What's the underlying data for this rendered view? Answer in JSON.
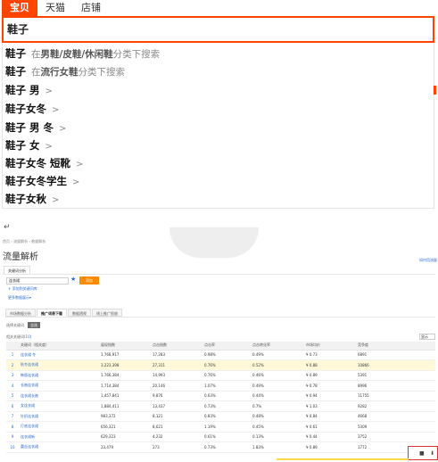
{
  "search": {
    "tabs": [
      "宝贝",
      "天猫",
      "店铺"
    ],
    "query": "鞋子"
  },
  "suggestions": [
    {
      "q": "鞋子",
      "hint_pre": "在",
      "hint_cat": "男鞋/皮鞋/休闲鞋",
      "hint_post": "分类下搜索"
    },
    {
      "q": "鞋子",
      "hint_pre": "在",
      "hint_cat": "流行女鞋",
      "hint_post": "分类下搜索"
    },
    {
      "q": "鞋子 男"
    },
    {
      "q": "鞋子女冬"
    },
    {
      "q": "鞋子 男 冬"
    },
    {
      "q": "鞋子 女"
    },
    {
      "q": "鞋子女冬 短靴"
    },
    {
      "q": "鞋子女冬学生"
    },
    {
      "q": "鞋子女秋"
    }
  ],
  "misc": {
    "return_mark": "↵",
    "chevron": ">"
  },
  "analytics": {
    "breadcrumb": "首页  ›  流量解析  ›  数据解析",
    "title": "流量解析",
    "help_link": "如何用流量",
    "subtab": "关键词分析",
    "keyword_input": "连衣裙",
    "add_button": "添加",
    "link_add": "+ 添加到关键词库",
    "link_more": "更多数据展示▾",
    "tabs": [
      "市场数据分析",
      "推广词表下载",
      "数据透视",
      "线上推广投放"
    ],
    "active_tab": 1,
    "select_label": "选择关键词",
    "select_chip": "全选",
    "kw_summary_label": "相关关键词",
    "kw_summary_count": "(10)",
    "mini_select": "显示",
    "table": {
      "headers": [
        "",
        "关键词（相关度）",
        "展现指数",
        "点击指数",
        "点击率",
        "点击转化率",
        "市场均价",
        "竞争度"
      ],
      "rows": [
        [
          "1",
          "连衣裙 冬",
          "1,768,917",
          "17,283",
          "0.98%",
          "0.49%",
          "¥ 0.73",
          "6891"
        ],
        [
          "2",
          "秋冬连衣裙",
          "3,223,398",
          "27,311",
          "0.76%",
          "0.52%",
          "¥ 0.88",
          "10866"
        ],
        [
          "3",
          "韩版连衣裙",
          "1,766,384",
          "14,993",
          "0.76%",
          "0.46%",
          "¥ 0.89",
          "5391"
        ],
        [
          "4",
          "长袖连衣裙",
          "1,714,384",
          "20,146",
          "1.07%",
          "0.49%",
          "¥ 0.78",
          "8996"
        ],
        [
          "5",
          "连衣裙长袖",
          "1,457,841",
          "9,876",
          "0.63%",
          "0.44%",
          "¥ 0.94",
          "11755"
        ],
        [
          "6",
          "女连衣裙",
          "1,884,411",
          "13,437",
          "0.73%",
          "0.7%",
          "¥ 1.03",
          "9282"
        ],
        [
          "7",
          "针织连衣裙",
          "983,372",
          "8,121",
          "0.83%",
          "0.48%",
          "¥ 0.84",
          "4668"
        ],
        [
          "8",
          "打底连衣裙",
          "656,321",
          "8,621",
          "1.19%",
          "0.45%",
          "¥ 0.61",
          "5309"
        ],
        [
          "9",
          "连衣裙新",
          "629,323",
          "4,232",
          "0.61%",
          "0.13%",
          "¥ 0.44",
          "3752"
        ],
        [
          "10",
          "蕾丝连衣裙",
          "23,479",
          "273",
          "0.73%",
          "1.83%",
          "¥ 0.89",
          "1772"
        ]
      ],
      "highlight_row": 1
    }
  },
  "colors": {
    "accent": "#ff4400",
    "link": "#2b6cd4",
    "button": "#ff8a00"
  }
}
